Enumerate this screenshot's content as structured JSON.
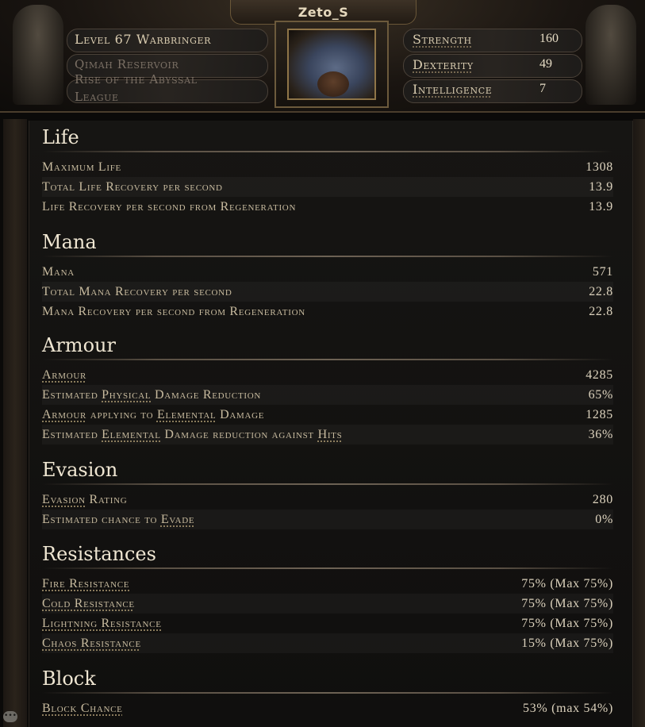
{
  "header": {
    "character_name": "Zeto_S",
    "level_text": "Level 67 Warbringer",
    "league_line1": "Qimah Reservoir",
    "league_line2": "Rise of the Abyssal",
    "league_line3": "League"
  },
  "attributes": [
    {
      "label": "Strength",
      "value": "160"
    },
    {
      "label": "Dexterity",
      "value": "49"
    },
    {
      "label": "Intelligence",
      "value": "7"
    }
  ],
  "sections": {
    "life": {
      "title": "Life",
      "rows": [
        {
          "label": "Maximum Life",
          "value": "1308"
        },
        {
          "label": "Total Life Recovery per second",
          "value": "13.9"
        },
        {
          "label": "Life Recovery per second from Regeneration",
          "value": "13.9"
        }
      ]
    },
    "mana": {
      "title": "Mana",
      "rows": [
        {
          "label": "Mana",
          "value": "571"
        },
        {
          "label": "Total Mana Recovery per second",
          "value": "22.8"
        },
        {
          "label": "Mana Recovery per second from Regeneration",
          "value": "22.8"
        }
      ]
    },
    "armour": {
      "title": "Armour",
      "rows": [
        {
          "label_parts": [
            "Armour"
          ],
          "value": "4285"
        },
        {
          "label_parts": [
            "Estimated ",
            "Physical",
            " Damage Reduction"
          ],
          "value": "65%"
        },
        {
          "label_parts": [
            "Armour",
            " applying to ",
            "Elemental",
            " Damage"
          ],
          "value": "1285"
        },
        {
          "label_parts": [
            "Estimated ",
            "Elemental",
            " Damage reduction against ",
            "Hits"
          ],
          "value": "36%"
        }
      ]
    },
    "evasion": {
      "title": "Evasion",
      "rows": [
        {
          "label_parts": [
            "Evasion",
            " Rating"
          ],
          "value": "280"
        },
        {
          "label_parts": [
            "Estimated chance to ",
            "Evade"
          ],
          "value": "0%"
        }
      ]
    },
    "resistances": {
      "title": "Resistances",
      "rows": [
        {
          "label": "Fire Resistance",
          "value": "75% (Max 75%)"
        },
        {
          "label": "Cold Resistance",
          "value": "75% (Max 75%)"
        },
        {
          "label": "Lightning Resistance",
          "value": "75% (Max 75%)"
        },
        {
          "label": "Chaos Resistance",
          "value": "15% (Max 75%)"
        }
      ]
    },
    "block": {
      "title": "Block",
      "rows": [
        {
          "label": "Block Chance",
          "value": "53% (max 54%)"
        }
      ]
    }
  },
  "icons": {
    "chat": "chat-bubble-icon"
  }
}
